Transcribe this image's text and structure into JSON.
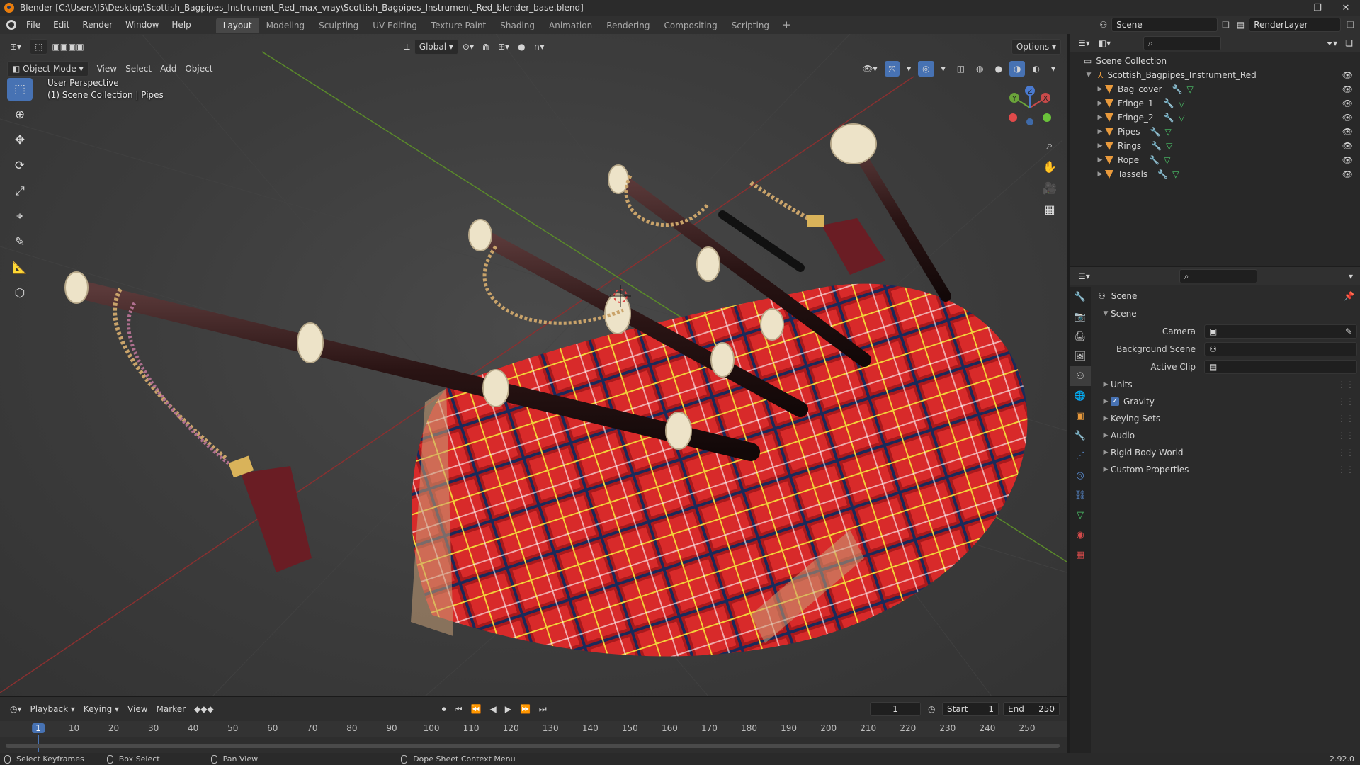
{
  "window": {
    "title": "Blender [C:\\Users\\I5\\Desktop\\Scottish_Bagpipes_Instrument_Red_max_vray\\Scottish_Bagpipes_Instrument_Red_blender_base.blend]",
    "controls": [
      "–",
      "❐",
      "✕"
    ]
  },
  "menu": {
    "items": [
      "File",
      "Edit",
      "Render",
      "Window",
      "Help"
    ]
  },
  "workspaces": [
    "Layout",
    "Modeling",
    "Sculpting",
    "UV Editing",
    "Texture Paint",
    "Shading",
    "Animation",
    "Rendering",
    "Compositing",
    "Scripting"
  ],
  "active_workspace": "Layout",
  "scene_selector": {
    "scene": "Scene",
    "view_layer": "RenderLayer"
  },
  "viewport": {
    "mode": "Object Mode",
    "menus": [
      "View",
      "Select",
      "Add",
      "Object"
    ],
    "orientation": "Global",
    "options_label": "Options",
    "overlay_line1": "User Perspective",
    "overlay_line2": "(1) Scene Collection | Pipes",
    "gizmo_axes": {
      "x": "X",
      "y": "Y",
      "z": "Z"
    }
  },
  "outliner": {
    "root": "Scene Collection",
    "collection": "Scottish_Bagpipes_Instrument_Red",
    "objects": [
      "Bag_cover",
      "Fringe_1",
      "Fringe_2",
      "Pipes",
      "Rings",
      "Rope",
      "Tassels"
    ]
  },
  "properties": {
    "context": "Scene",
    "panel": "Scene",
    "fields": [
      {
        "label": "Camera",
        "value": ""
      },
      {
        "label": "Background Scene",
        "value": ""
      },
      {
        "label": "Active Clip",
        "value": ""
      }
    ],
    "subpanels": [
      "Units",
      "Gravity",
      "Keying Sets",
      "Audio",
      "Rigid Body World",
      "Custom Properties"
    ],
    "gravity_checked": true
  },
  "timeline": {
    "menus": [
      "Playback",
      "Keying",
      "View",
      "Marker"
    ],
    "current_frame": "1",
    "start_label": "Start",
    "start": "1",
    "end_label": "End",
    "end": "250",
    "ticks": [
      "1",
      "10",
      "20",
      "30",
      "40",
      "50",
      "60",
      "70",
      "80",
      "90",
      "100",
      "110",
      "120",
      "130",
      "140",
      "150",
      "160",
      "170",
      "180",
      "190",
      "200",
      "210",
      "220",
      "230",
      "240",
      "250"
    ]
  },
  "status": {
    "items": [
      "Select Keyframes",
      "Box Select",
      "Pan View",
      "Dope Sheet Context Menu"
    ],
    "version": "2.92.0"
  },
  "colors": {
    "accent": "#4772b3",
    "object_icon": "#e99a3c",
    "tartan_red": "#d82a2a"
  }
}
